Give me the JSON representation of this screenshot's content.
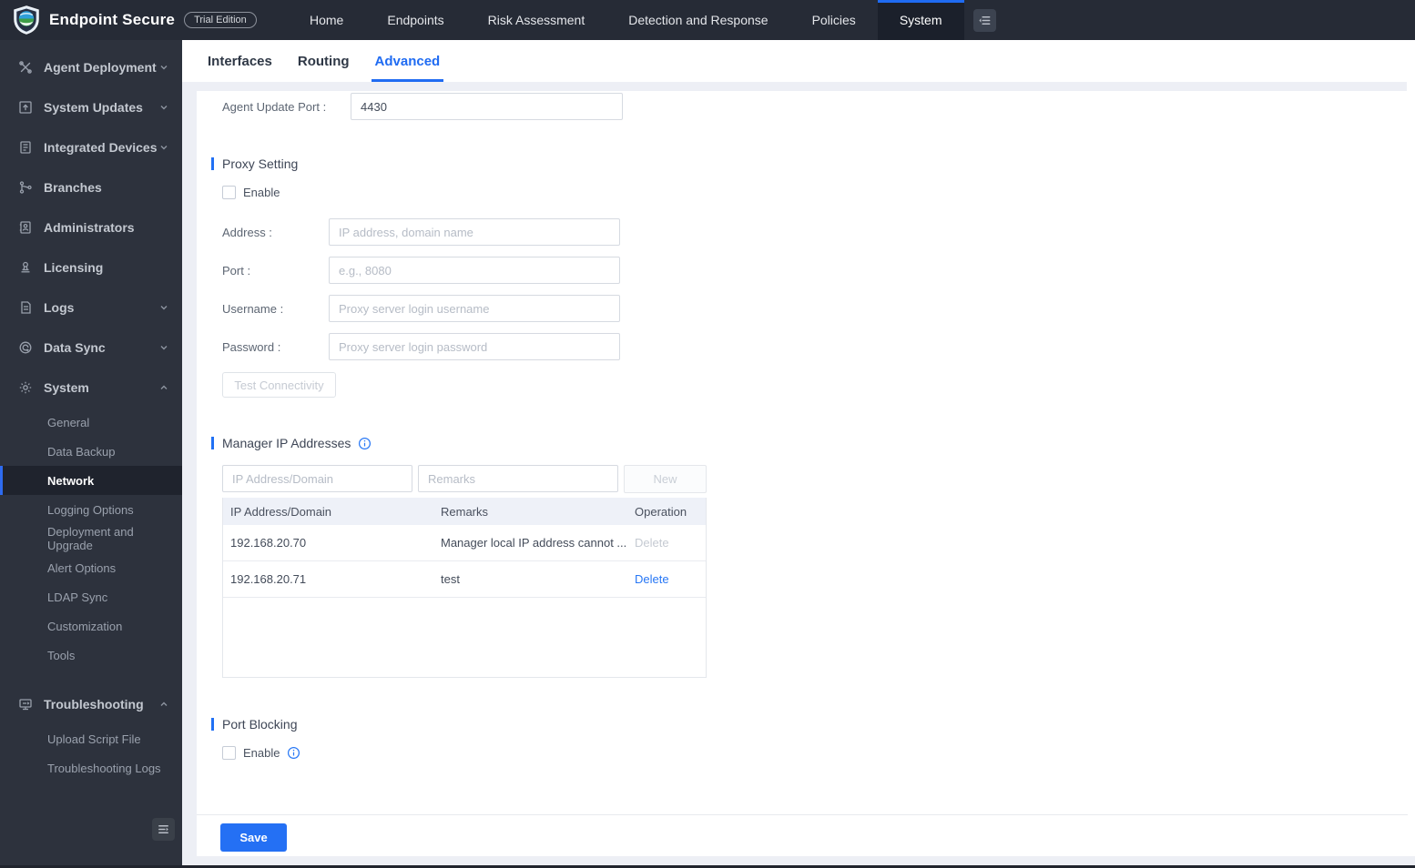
{
  "topbar": {
    "brand": {
      "title": "Endpoint Secure",
      "badge": "Trial Edition"
    },
    "nav": [
      {
        "label": "Home"
      },
      {
        "label": "Endpoints"
      },
      {
        "label": "Risk Assessment"
      },
      {
        "label": "Detection and Response"
      },
      {
        "label": "Policies"
      },
      {
        "label": "System",
        "active": true
      }
    ]
  },
  "sidebar": {
    "items": [
      {
        "label": "Agent Deployment",
        "icon": "tools-icon",
        "chevron": "down"
      },
      {
        "label": "System Updates",
        "icon": "system-updates-icon",
        "chevron": "down"
      },
      {
        "label": "Integrated Devices",
        "icon": "integrated-devices-icon",
        "chevron": "down"
      },
      {
        "label": "Branches",
        "icon": "branches-icon"
      },
      {
        "label": "Administrators",
        "icon": "administrators-icon"
      },
      {
        "label": "Licensing",
        "icon": "licensing-icon"
      },
      {
        "label": "Logs",
        "icon": "logs-icon",
        "chevron": "down"
      },
      {
        "label": "Data Sync",
        "icon": "data-sync-icon",
        "chevron": "down"
      },
      {
        "label": "System",
        "icon": "gear-icon",
        "chevron": "up",
        "expanded": true,
        "children": [
          {
            "label": "General"
          },
          {
            "label": "Data Backup"
          },
          {
            "label": "Network",
            "active": true
          },
          {
            "label": "Logging Options"
          },
          {
            "label": "Deployment and Upgrade"
          },
          {
            "label": "Alert Options"
          },
          {
            "label": "LDAP Sync"
          },
          {
            "label": "Customization"
          },
          {
            "label": "Tools"
          }
        ]
      },
      {
        "label": "Troubleshooting",
        "icon": "troubleshooting-icon",
        "chevron": "up",
        "expanded": true,
        "children": [
          {
            "label": "Upload Script File"
          },
          {
            "label": "Troubleshooting Logs"
          }
        ]
      }
    ]
  },
  "tabs": [
    {
      "label": "Interfaces"
    },
    {
      "label": "Routing"
    },
    {
      "label": "Advanced",
      "active": true
    }
  ],
  "content": {
    "agent_update_port": {
      "label": "Agent Update Port :",
      "value": "4430"
    },
    "proxy": {
      "title": "Proxy Setting",
      "enable_label": "Enable",
      "fields": [
        {
          "label": "Address :",
          "placeholder": "IP address, domain name"
        },
        {
          "label": "Port :",
          "placeholder": "e.g., 8080"
        },
        {
          "label": "Username :",
          "placeholder": "Proxy server login username"
        },
        {
          "label": "Password :",
          "placeholder": "Proxy server login password"
        }
      ],
      "test_button": "Test Connectivity"
    },
    "manager_ips": {
      "title": "Manager IP Addresses",
      "ip_placeholder": "IP Address/Domain",
      "remarks_placeholder": "Remarks",
      "new_button": "New",
      "table": {
        "headers": [
          "IP Address/Domain",
          "Remarks",
          "Operation"
        ],
        "rows": [
          {
            "ip": "192.168.20.70",
            "remarks": "Manager local IP address cannot ...",
            "operation": "Delete",
            "operation_disabled": true
          },
          {
            "ip": "192.168.20.71",
            "remarks": "test",
            "operation": "Delete",
            "operation_disabled": false
          }
        ]
      }
    },
    "port_blocking": {
      "title": "Port Blocking",
      "enable_label": "Enable"
    },
    "save_button": "Save"
  },
  "colors": {
    "accent_blue": "#2170f4",
    "topbar_bg": "#262b36",
    "sidebar_bg": "#2d323d",
    "active_nav_bg": "#1b202b",
    "table_header_bg": "#eef1f8",
    "page_bg": "#edeff5"
  }
}
